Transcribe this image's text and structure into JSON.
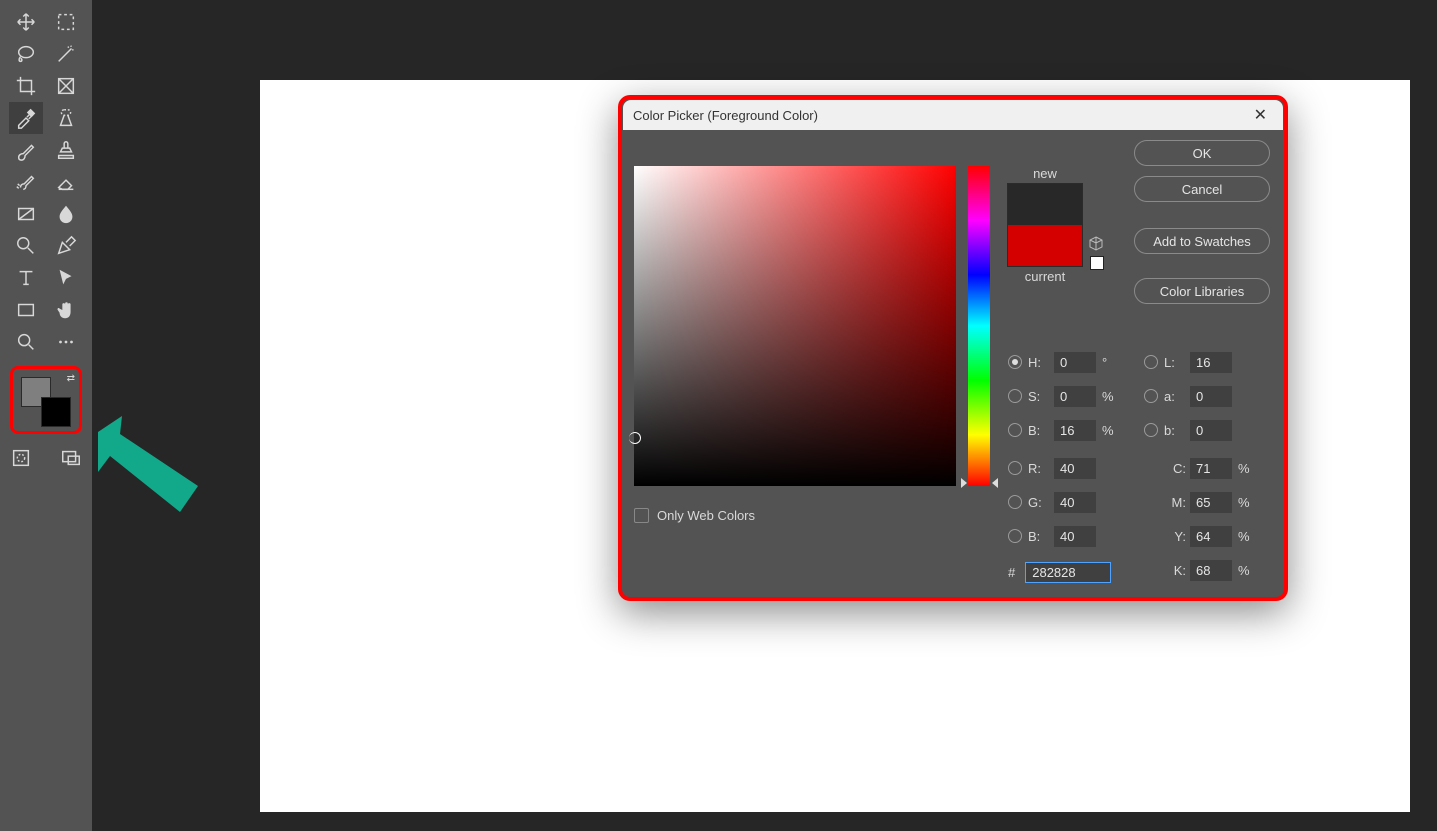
{
  "dialog": {
    "title": "Color Picker (Foreground Color)",
    "buttons": {
      "ok": "OK",
      "cancel": "Cancel",
      "add": "Add to Swatches",
      "lib": "Color Libraries"
    },
    "preview": {
      "new_label": "new",
      "current_label": "current"
    },
    "webonly": "Only Web Colors",
    "hsb": {
      "H": "H:",
      "S": "S:",
      "B": "B:",
      "deg": "°",
      "pct": "%",
      "Hv": "0",
      "Sv": "0",
      "Bv": "16"
    },
    "lab": {
      "L": "L:",
      "a": "a:",
      "b": "b:",
      "Lv": "16",
      "av": "0",
      "bv": "0"
    },
    "rgb": {
      "R": "R:",
      "G": "G:",
      "B": "B:",
      "Rv": "40",
      "Gv": "40",
      "Bv": "40"
    },
    "cmyk": {
      "C": "C:",
      "M": "M:",
      "Y": "Y:",
      "K": "K:",
      "Cv": "71",
      "Mv": "65",
      "Yv": "64",
      "Kv": "68",
      "pct": "%"
    },
    "hex": {
      "label": "#",
      "value": "282828"
    }
  },
  "colors": {
    "fg": "#7f7f7f",
    "bg": "#000000",
    "new": "#282828",
    "current": "#d40000"
  }
}
